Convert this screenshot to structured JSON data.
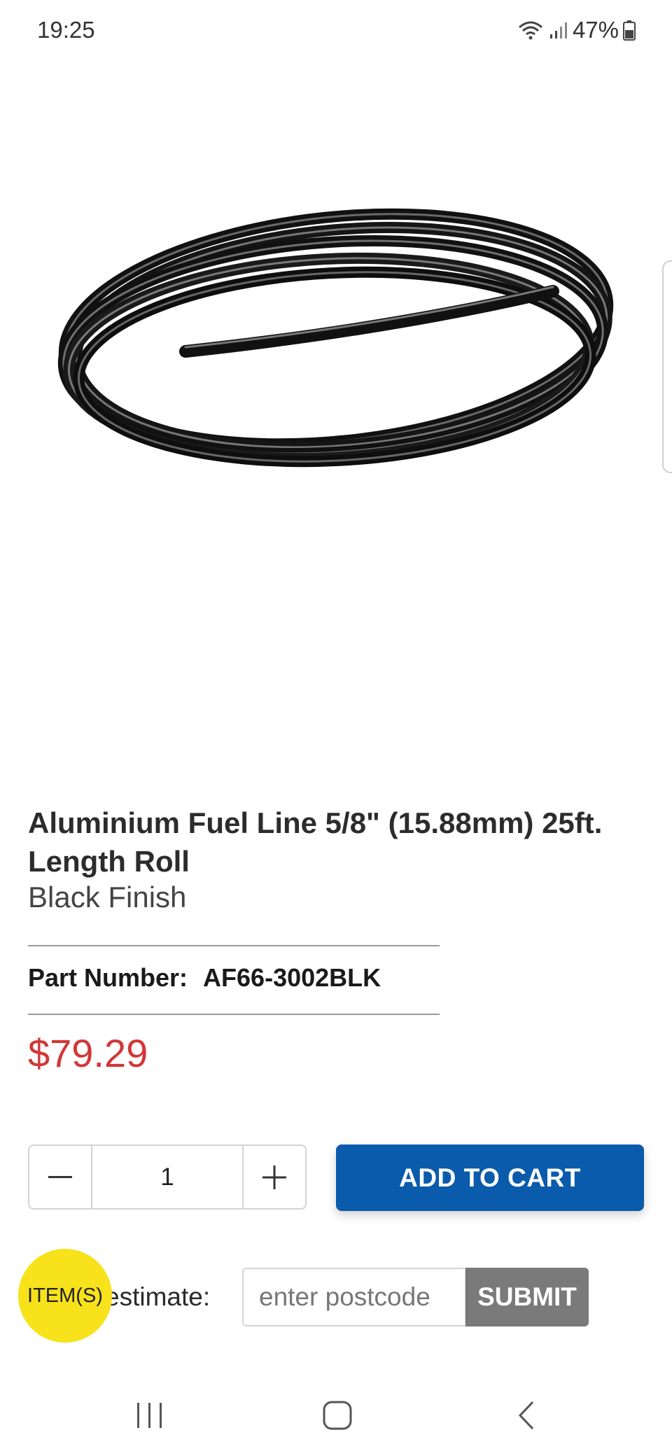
{
  "status_bar": {
    "time": "19:25",
    "battery": "47%",
    "icons": [
      "wifi-icon",
      "signal-icon",
      "battery-icon"
    ]
  },
  "product": {
    "image_icon": "coiled-fuel-line-image",
    "title": "Aluminium Fuel Line 5/8\" (15.88mm) 25ft. Length Roll",
    "finish": "Black Finish",
    "part_number_label": "Part Number:",
    "part_number": "AF66-3002BLK",
    "price": "$79.29"
  },
  "cart": {
    "quantity": "1",
    "add_to_cart_label": "ADD TO CART"
  },
  "shipping": {
    "estimate_label": "estimate:",
    "postcode_placeholder": "enter postcode",
    "submit_label": "SUBMIT"
  },
  "cart_badge": {
    "label": "ITEM(S)"
  },
  "colors": {
    "price": "#d23737",
    "add_to_cart": "#0a5bab",
    "submit": "#7a7a7a",
    "badge": "#f7e21b"
  },
  "nav_bar": {
    "icons": [
      "recent-apps-icon",
      "home-icon",
      "back-icon"
    ]
  }
}
